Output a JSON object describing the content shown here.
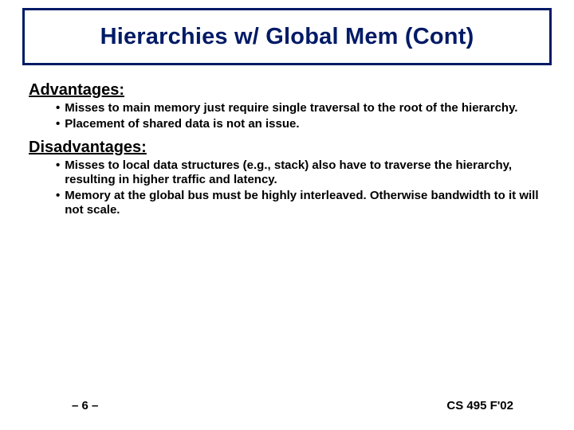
{
  "title": "Hierarchies w/ Global Mem (Cont)",
  "sections": {
    "advantages": {
      "heading": "Advantages:",
      "bullets": [
        "Misses to main memory just require single traversal to the root of the hierarchy.",
        "Placement of shared data is not an issue."
      ]
    },
    "disadvantages": {
      "heading": "Disadvantages:",
      "bullets": [
        "Misses to local data structures (e.g., stack) also have to traverse the hierarchy, resulting in higher traffic and latency.",
        "Memory at the global bus must be highly interleaved.  Otherwise bandwidth to it will not scale."
      ]
    }
  },
  "footer": {
    "page": "– 6 –",
    "course": "CS 495 F'02"
  }
}
